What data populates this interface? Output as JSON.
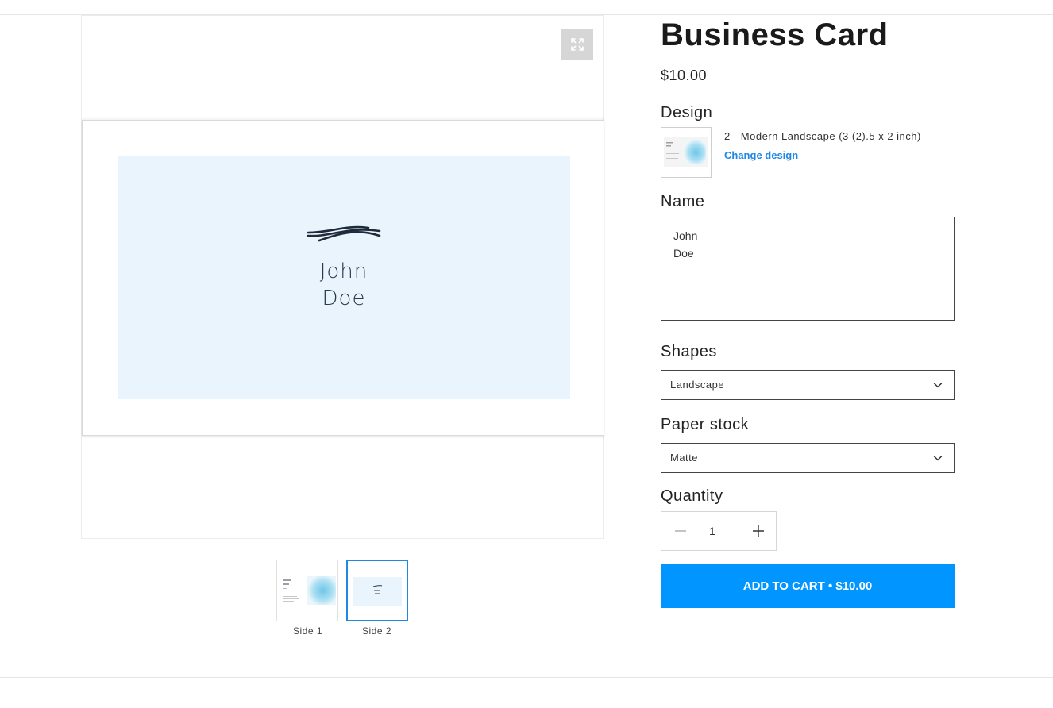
{
  "product": {
    "title": "Business Card",
    "price": "$10.00"
  },
  "preview": {
    "card_name_line1": "John",
    "card_name_line2": "Doe",
    "thumbnails": [
      {
        "label": "Side 1"
      },
      {
        "label": "Side 2"
      }
    ],
    "selected_thumbnail": 2
  },
  "design": {
    "label": "Design",
    "name": "2 - Modern Landscape (3 (2).5 x 2 inch)",
    "change_label": "Change design"
  },
  "name_field": {
    "label": "Name",
    "value": "John\nDoe"
  },
  "shapes": {
    "label": "Shapes",
    "selected": "Landscape"
  },
  "paper_stock": {
    "label": "Paper stock",
    "selected": "Matte"
  },
  "quantity": {
    "label": "Quantity",
    "value": "1"
  },
  "cart": {
    "button_label": "ADD TO CART • $10.00"
  },
  "colors": {
    "accent": "#0095ff",
    "link": "#1e88e5",
    "card_background": "#eaf4fd"
  },
  "icons": {
    "expand": "expand-icon",
    "chevron": "chevron-down-icon",
    "minus": "minus-icon",
    "plus": "plus-icon"
  }
}
